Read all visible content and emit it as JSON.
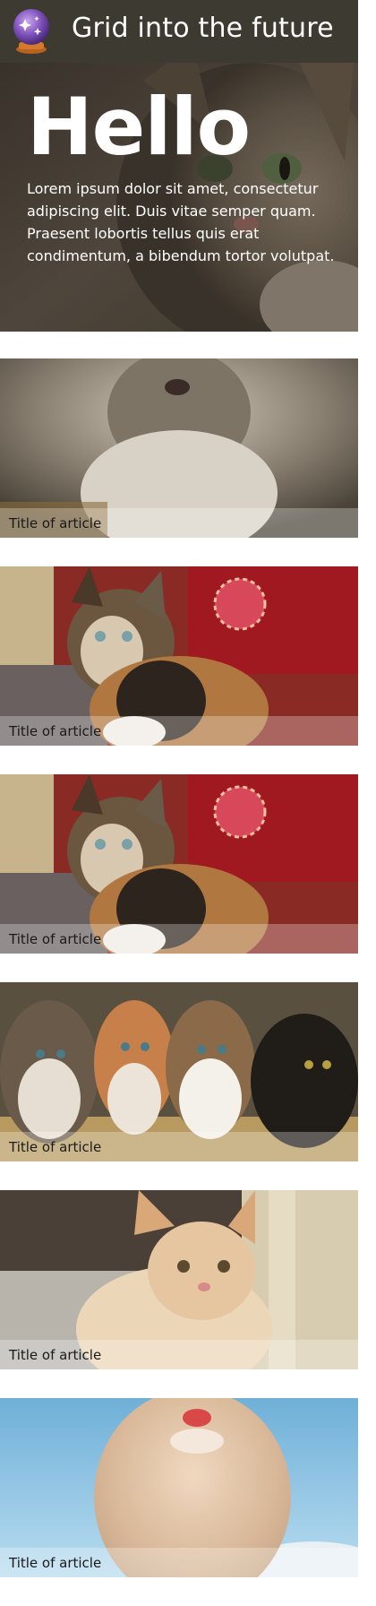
{
  "header": {
    "title": "Grid into the future",
    "logo_icon": "crystal-ball-icon"
  },
  "hero": {
    "heading": "Hello",
    "text": "Lorem ipsum dolor sit amet, consectetur adipiscing elit. Duis vitae semper quam. Praesent lobortis tellus quis erat condimentum, a bibendum tortor volutpat.",
    "image": "tabby-cat-photo"
  },
  "articles": [
    {
      "title": "Title of article",
      "image": "grey-kitten-photo"
    },
    {
      "title": "Title of article",
      "image": "calico-kitten-with-ornament-photo"
    },
    {
      "title": "Title of article",
      "image": "calico-kitten-with-ornament-photo"
    },
    {
      "title": "Title of article",
      "image": "four-kittens-photo"
    },
    {
      "title": "Title of article",
      "image": "orange-kitten-photo"
    },
    {
      "title": "Title of article",
      "image": "kitten-sky-photo"
    }
  ],
  "colors": {
    "header_bg": "#3d3a31",
    "text_light": "#ffffff",
    "card_title_text": "#1a1a1a"
  }
}
